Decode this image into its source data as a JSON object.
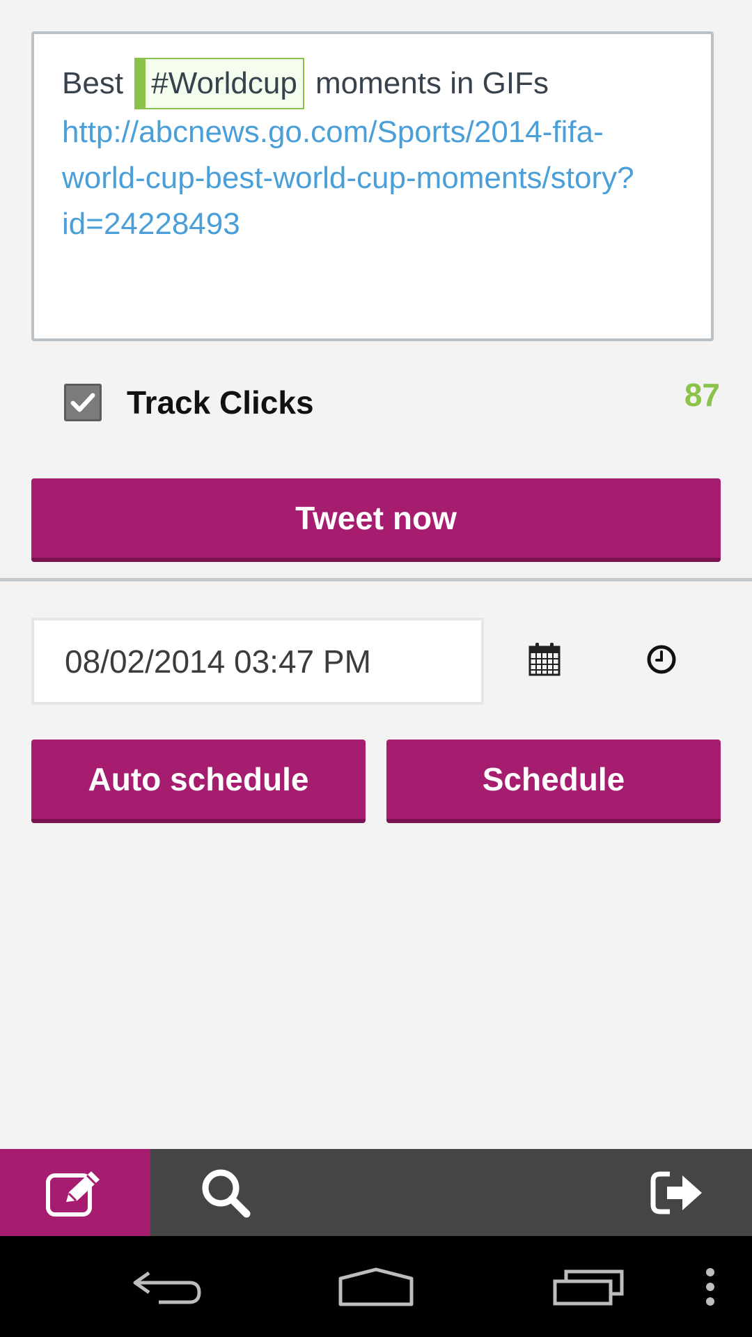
{
  "compose": {
    "text_before": "Best",
    "hashtag": "#Worldcup",
    "text_after": "moments in GIFs",
    "link": "http://abcnews.go.com/Sports/2014-fifa-world-cup-best-world-cup-moments/story?id=24228493"
  },
  "track_clicks": {
    "label": "Track Clicks",
    "checked": true
  },
  "char_count": "87",
  "buttons": {
    "tweet_now": "Tweet now",
    "auto_schedule": "Auto schedule",
    "schedule": "Schedule"
  },
  "schedule": {
    "datetime": "08/02/2014 03:47 PM"
  },
  "icons": {
    "calendar": "calendar-icon",
    "clock": "clock-icon",
    "compose": "compose-icon",
    "search": "search-icon",
    "logout": "logout-icon"
  },
  "colors": {
    "accent": "#a61d6f",
    "hashtag_green": "#8bc34a",
    "link_blue": "#4a9fd8",
    "tab_bar": "#454545"
  }
}
